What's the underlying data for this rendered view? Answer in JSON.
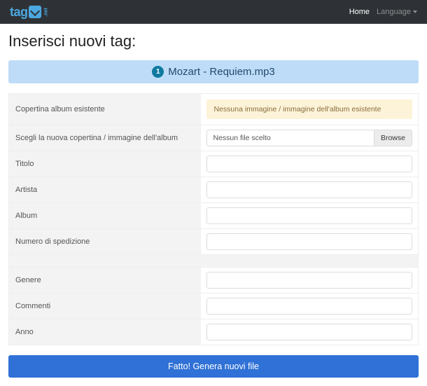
{
  "nav": {
    "home": "Home",
    "language": "Language"
  },
  "brand": {
    "text": "tag",
    "suffix": ".net"
  },
  "page": {
    "heading": "Inserisci nuovi tag:"
  },
  "file": {
    "badge": "1",
    "name": "Mozart - Requiem.mp3"
  },
  "form": {
    "cover_existing_label": "Copertina album esistente",
    "cover_existing_warn": "Nessuna immagine / immagine dell'album esistente",
    "choose_cover_label": "Scegli la nuova copertina / immagine dell'album",
    "no_file": "Nessun file scelto",
    "browse": "Browse",
    "title_label": "Titolo",
    "artist_label": "Artista",
    "album_label": "Album",
    "track_label": "Numero di spedizione",
    "genre_label": "Genere",
    "comments_label": "Commenti",
    "year_label": "Anno"
  },
  "submit": "Fatto! Genera nuovi file"
}
